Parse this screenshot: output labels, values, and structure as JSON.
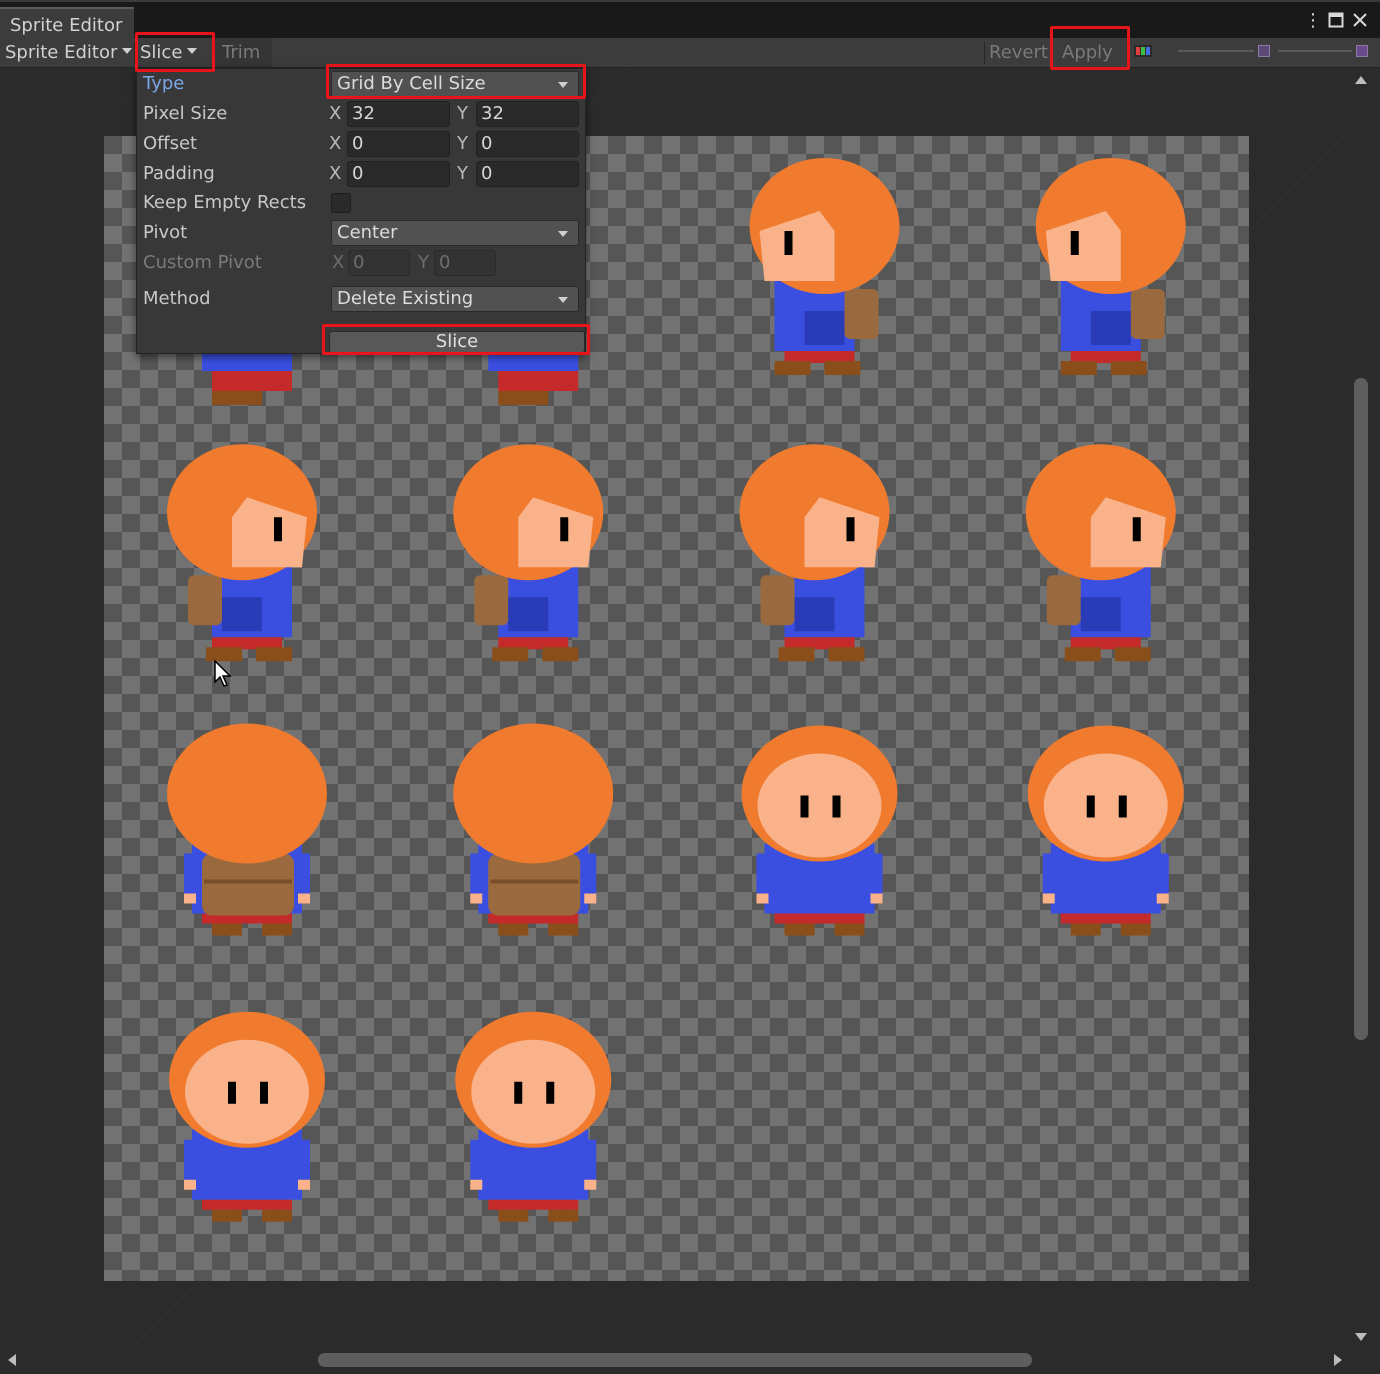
{
  "window": {
    "tab_title": "Sprite Editor",
    "more_icon": "kebab-menu-icon",
    "maximize_icon": "maximize-icon",
    "close_icon": "close-icon"
  },
  "toolbar": {
    "mode_label": "Sprite Editor",
    "slice_label": "Slice",
    "trim_label": "Trim",
    "revert_label": "Revert",
    "apply_label": "Apply",
    "color_channel_icon": "rgb-channels-icon",
    "zoom_icon": "zoom-slider-icon",
    "mip_icon": "mip-level-icon"
  },
  "slice_popup": {
    "type": {
      "label": "Type",
      "value": "Grid By Cell Size"
    },
    "pixel_size": {
      "label": "Pixel Size",
      "x_label": "X",
      "x": "32",
      "y_label": "Y",
      "y": "32"
    },
    "offset": {
      "label": "Offset",
      "x_label": "X",
      "x": "0",
      "y_label": "Y",
      "y": "0"
    },
    "padding": {
      "label": "Padding",
      "x_label": "X",
      "x": "0",
      "y_label": "Y",
      "y": "0"
    },
    "keep_empty": {
      "label": "Keep Empty Rects",
      "checked": false
    },
    "pivot": {
      "label": "Pivot",
      "value": "Center"
    },
    "custom_pivot": {
      "label": "Custom Pivot",
      "x_label": "X",
      "x": "0",
      "y_label": "Y",
      "y": "0"
    },
    "method": {
      "label": "Method",
      "value": "Delete Existing"
    },
    "slice_button": "Slice"
  },
  "colors": {
    "highlight": "#e8141b",
    "hair": "#f07a2e",
    "skin": "#f9b28a",
    "shirt": "#3a4fe0",
    "pants": "#c42a2a",
    "boots": "#8a4e1a",
    "pack": "#9a6a3e"
  },
  "sprite_sheet": {
    "rows": [
      [
        "walk-down-hidden",
        "walk-down-hidden",
        "side-right",
        "side-right"
      ],
      [
        "side-left",
        "side-left",
        "side-left",
        "side-left"
      ],
      [
        "back",
        "back",
        "front",
        "front"
      ],
      [
        "front",
        "front"
      ]
    ]
  }
}
